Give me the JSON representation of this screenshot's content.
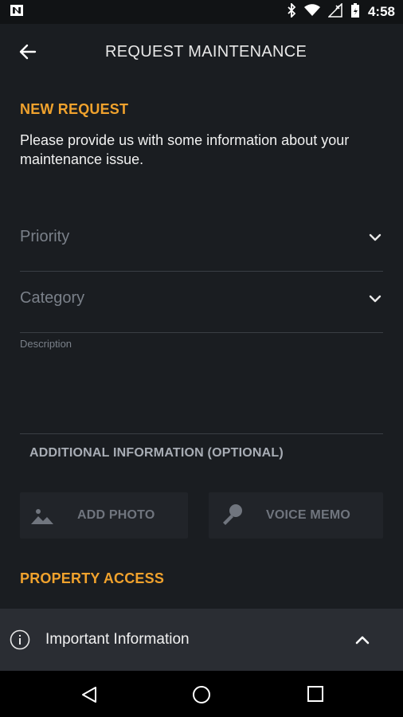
{
  "status": {
    "time": "4:58",
    "left_icon": "n-notification-icon"
  },
  "appbar": {
    "title": "REQUEST MAINTENANCE"
  },
  "sections": {
    "new_request": "NEW REQUEST",
    "intro": "Please provide us with some information about your maintenance issue.",
    "property_access": "PROPERTY ACCESS"
  },
  "form": {
    "priority_label": "Priority",
    "category_label": "Category",
    "description_label": "Description"
  },
  "additional": {
    "title": "ADDITIONAL INFORMATION (OPTIONAL)",
    "add_photo": "ADD PHOTO",
    "voice_memo": "VOICE MEMO"
  },
  "info_bar": {
    "text": "Important Information"
  },
  "colors": {
    "accent": "#f0a22d",
    "background": "#1a1d21",
    "panel": "#2a2d33"
  }
}
